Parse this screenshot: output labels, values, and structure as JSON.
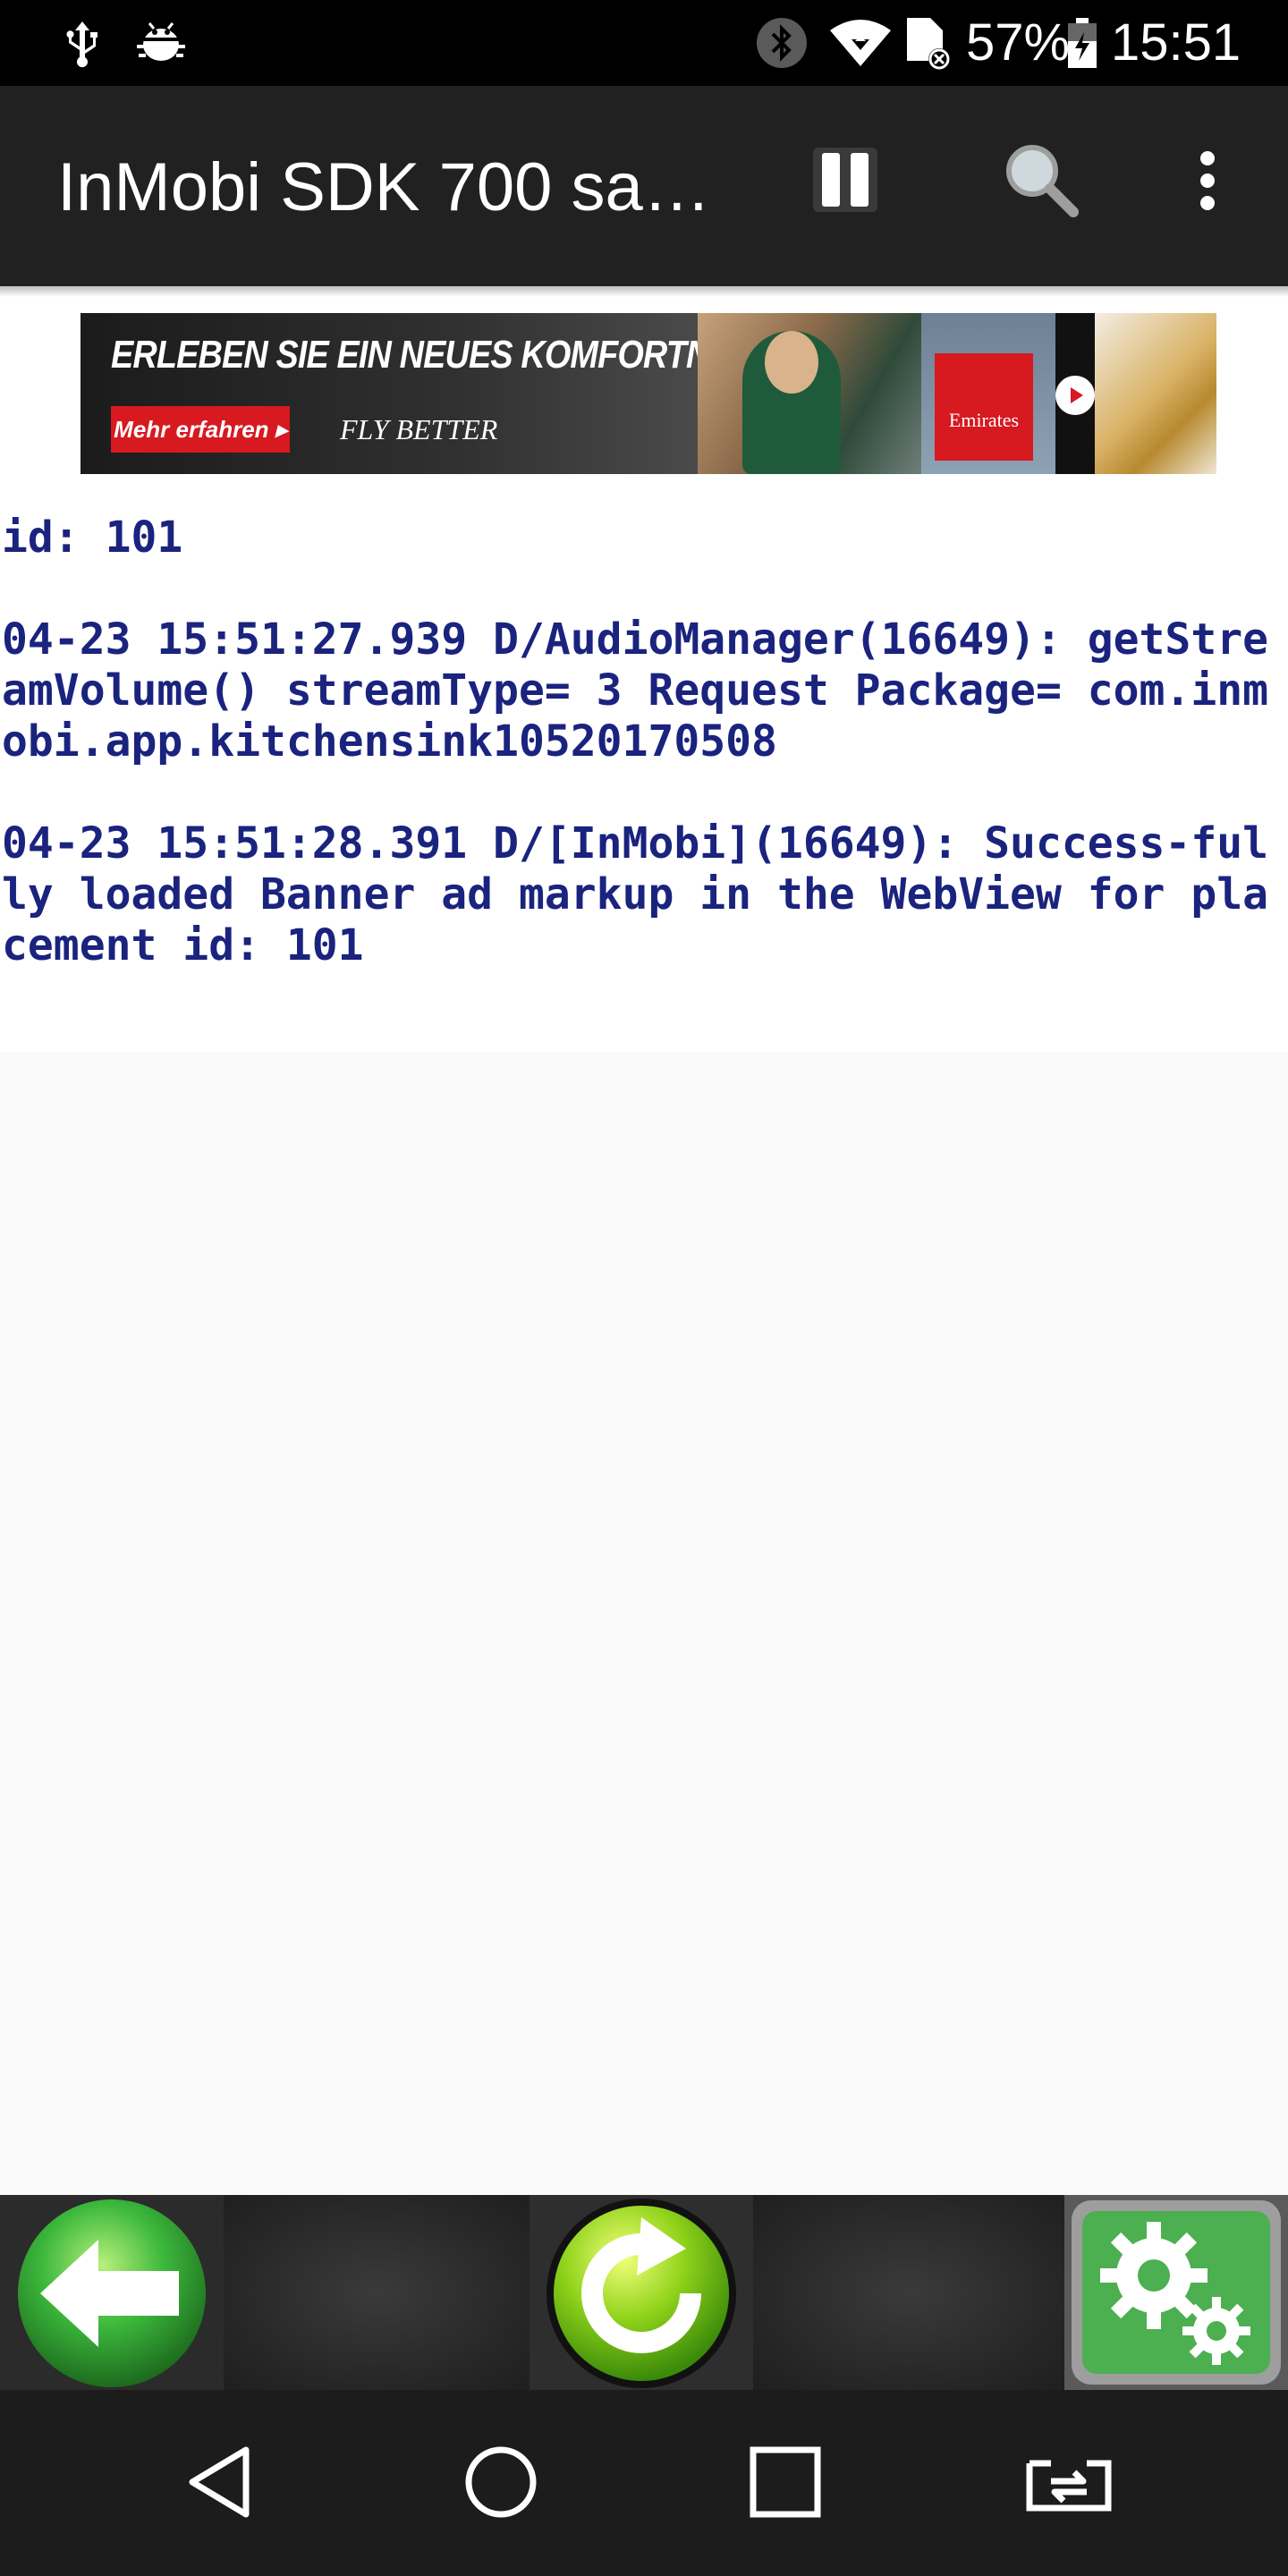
{
  "status_bar": {
    "icons_left": [
      "usb-icon",
      "android-debug-icon"
    ],
    "icons_right": [
      "bluetooth-icon",
      "wifi-icon",
      "sim-no-signal-icon",
      "battery-charging-icon"
    ],
    "battery_percent": "57%",
    "time": "15:51"
  },
  "toolbar": {
    "title": "InMobi SDK 700 sa…",
    "actions": [
      "pause-icon",
      "search-icon",
      "more-options-icon"
    ]
  },
  "ad_banner": {
    "headline": "ERLEBEN SIE EIN NEUES KOMFORTNIVEAU",
    "cta": "Mehr erfahren ▸",
    "tagline": "FLY BETTER",
    "brand": "Emirates"
  },
  "log": {
    "partial_top": "id: 101",
    "entries": [
      "04-23 15:51:27.939 D/AudioManager(16649): getStreamVolume() streamType= 3 Request Package= com.inmobi.app.kitchensink10520170508",
      "04-23 15:51:28.391 D/[InMobi](16649): Success-fully loaded Banner ad markup in the WebView for placement id: 101"
    ]
  },
  "bottom_bar": {
    "buttons": [
      "back-arrow-icon",
      "refresh-icon",
      "settings-gears-icon"
    ]
  },
  "nav_bar": {
    "buttons": [
      "nav-back-icon",
      "nav-home-icon",
      "nav-recents-icon",
      "nav-screen-mirror-icon"
    ]
  },
  "colors": {
    "log_text": "#1a237e",
    "toolbar_bg": "#212121",
    "status_bg": "#000000",
    "green_button": "#3cb83c"
  }
}
